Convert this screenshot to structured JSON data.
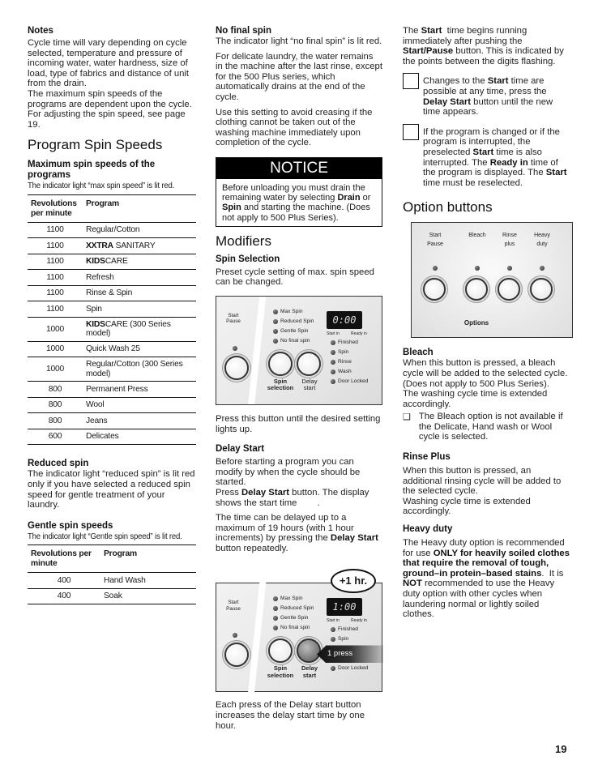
{
  "page_number": "19",
  "col1": {
    "notes_heading": "Notes",
    "notes_p1": "Cycle time will vary depending on cycle selected, temperature and pressure of incoming water, water hardness, size of load, type of fabrics and distance of unit from the drain.",
    "notes_p2": "The maximum spin speeds of the programs are dependent upon the cycle. For adjusting the spin speed, see page 19.",
    "section_title": "Program Spin Speeds",
    "max_heading": "Maximum spin speeds of the programs",
    "max_caption": "The indicator light “max spin speed” is lit red.",
    "table_headers": {
      "rpm": "Revolutions per minute",
      "program": "Program"
    },
    "max_table": [
      {
        "rpm": "1100",
        "bold": "",
        "program": "Regular/Cotton"
      },
      {
        "rpm": "1100",
        "bold": "XXTRA",
        "program": " SANITARY"
      },
      {
        "rpm": "1100",
        "bold": "KIDS",
        "program": "CARE"
      },
      {
        "rpm": "1100",
        "bold": "",
        "program": "Refresh"
      },
      {
        "rpm": "1100",
        "bold": "",
        "program": "Rinse & Spin"
      },
      {
        "rpm": "1100",
        "bold": "",
        "program": "Spin"
      },
      {
        "rpm": "1000",
        "bold": "KIDS",
        "program": "CARE (300 Series model)"
      },
      {
        "rpm": "1000",
        "bold": "",
        "program": "Quick Wash 25"
      },
      {
        "rpm": "1000",
        "bold": "",
        "program": "Regular/Cotton (300 Series model)"
      },
      {
        "rpm": "800",
        "bold": "",
        "program": "Permanent Press"
      },
      {
        "rpm": "800",
        "bold": "",
        "program": "Wool"
      },
      {
        "rpm": "800",
        "bold": "",
        "program": "Jeans"
      },
      {
        "rpm": "600",
        "bold": "",
        "program": "Delicates"
      }
    ],
    "reduced_heading": "Reduced spin",
    "reduced_text": "The indicator light “reduced spin” is lit red only if you have selected a reduced spin speed for gentle treatment of your laundry.",
    "gentle_heading": "Gentle spin speeds",
    "gentle_caption": "The indicator light “Gentle spin speed” is lit red.",
    "gentle_table": [
      {
        "rpm": "400",
        "program": "Hand Wash"
      },
      {
        "rpm": "400",
        "program": "Soak"
      }
    ]
  },
  "col2": {
    "nofinal_heading": "No final spin",
    "nofinal_p1": "The indicator light “no final spin” is lit red.",
    "nofinal_p2": "For delicate laundry, the water remains in the machine after the last rinse, except for the 500 Plus series, which automatically drains at the end of the cycle.",
    "nofinal_p3": "Use this setting to avoid creasing if the clothing cannot be taken out of the washing machine immediately upon completion of the cycle.",
    "notice_title": "NOTICE",
    "notice_a": "Before unloading you must drain the remaining water by selecting ",
    "notice_drain": "Drain",
    "notice_b": " or ",
    "notice_spin": "Spin",
    "notice_c": " and starting the machine. (Does not apply to 500 Plus Series).",
    "modifiers_title": "Modifiers",
    "spinsel_heading": "Spin Selection",
    "spinsel_text": "Preset cycle setting of max. spin speed can be changed.",
    "spinsel_after": "Press this button until the desired setting lights up.",
    "delay_heading": "Delay Start",
    "delay_p1": "Before starting a program you can modify by when the cycle should be started.",
    "delay_p2a": "Press ",
    "delay_p2b": "Delay Start",
    "delay_p2c": " button. The display shows the start time        .",
    "delay_p3a": "The time can be delayed up to a maximum of 19 hours (with 1 hour increments) by pressing the ",
    "delay_p3b": "Delay Start",
    "delay_p3c": " button repeatedly.",
    "delay_after": "Each press of the Delay start button increases the delay start time by one hour."
  },
  "panel": {
    "start_pause": "Start\nPause",
    "spin_options": [
      "Max Spin",
      "Reduced Spin",
      "Gentle Spin",
      "No final spin"
    ],
    "display_1": "0:00",
    "display_2": "1:00",
    "start_in": "Start in",
    "ready_in": "Ready in",
    "status": [
      "Finished",
      "Spin",
      "Rinse",
      "Wash",
      "Door Locked"
    ],
    "spin_selection": "Spin\nselection",
    "delay_start": "Delay\nstart",
    "bubble": "+1 hr.",
    "press": "1 press"
  },
  "col3": {
    "p1a": "The ",
    "p1b": "Start",
    "p1c": "  time begins running immediately after pushing the ",
    "p1d": "Start/Pause",
    "p1e": " button. This is indicated by the points between the digits flashing.",
    "note1a": "Changes to the ",
    "note1b": "Start",
    "note1c": " time are possible at any time, press the ",
    "note1d": "Delay Start",
    "note1e": " button until the new time appears.",
    "note2a": "If the program is changed or if the program is interrupted, the preselected ",
    "note2b": "Start",
    "note2c": " time is also interrupted. The ",
    "note2d": "Ready in",
    "note2e": " time of the program is displayed. The ",
    "note2f": "Start",
    "note2g": " time must be reselected.",
    "options_title": "Option buttons",
    "opt_labels": [
      "Start\nPause",
      "Bleach",
      "Rinse\nplus",
      "Heavy\nduty"
    ],
    "opt_caption": "Options",
    "bleach_heading": "Bleach",
    "bleach_text": "When this button is pressed, a bleach cycle will be added to the selected cycle.   (Does not apply to 500 Plus Series).\nThe washing cycle time is extended accordingly.",
    "bleach_bullet": "The Bleach option is not available if the Delicate, Hand wash or Wool cycle is selected.",
    "rinse_heading": "Rinse Plus",
    "rinse_text": "When this button is pressed, an additional rinsing cycle will be added to the selected cycle.\nWashing cycle time is extended accordingly.",
    "heavy_heading": "Heavy duty",
    "heavy_a": "The Heavy duty option is recommended for use ",
    "heavy_b": "ONLY for heavily soiled clothes that require the removal of tough, ground–in protein–based stains",
    "heavy_c": ".  It is ",
    "heavy_d": "NOT",
    "heavy_e": " recommended to use the Heavy duty option with other cycles when laundering normal or lightly soiled clothes."
  }
}
